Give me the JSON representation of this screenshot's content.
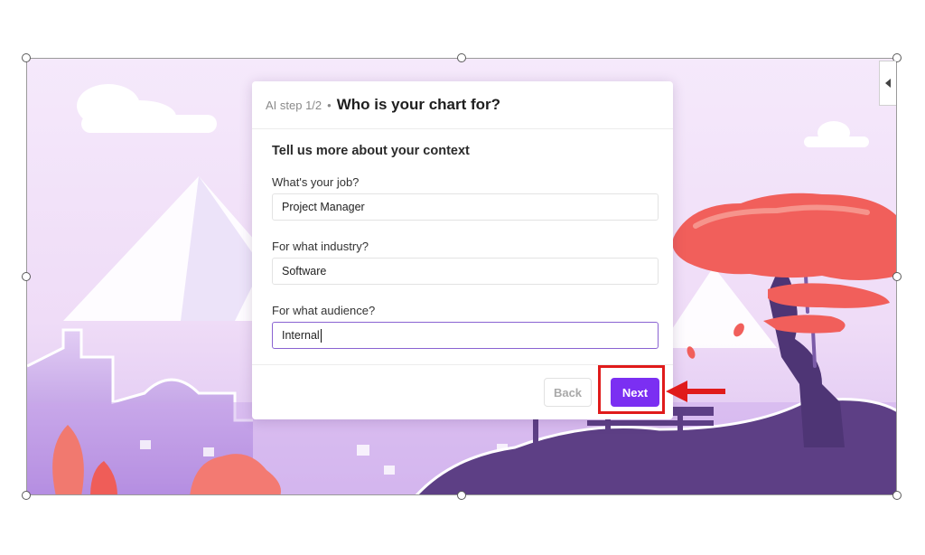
{
  "dialog": {
    "step": "AI step 1/2",
    "separator": "•",
    "title": "Who is your chart for?",
    "subtitle": "Tell us more about your context",
    "fields": [
      {
        "label": "What's your job?",
        "value": "Project Manager"
      },
      {
        "label": "For what industry?",
        "value": "Software"
      },
      {
        "label": "For what audience?",
        "value": "Internal"
      }
    ],
    "back_label": "Back",
    "next_label": "Next"
  },
  "colors": {
    "accent": "#7b2ff2",
    "annotation": "#e01b1b",
    "focus_border": "#8a63d2"
  },
  "icons": [
    "collapse-arrow-icon",
    "red-arrow-icon"
  ]
}
